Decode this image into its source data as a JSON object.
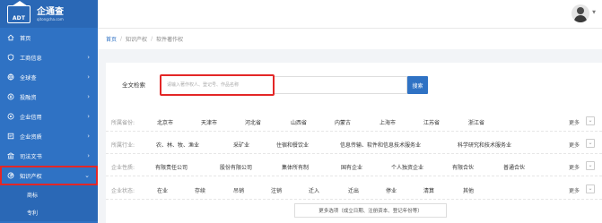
{
  "sidebar": {
    "logo": {
      "abbr": "ADT",
      "name": "企通查",
      "url": "qitongcha.com"
    },
    "items": [
      {
        "label": "首页",
        "icon": "home-icon",
        "has_arrow": false
      },
      {
        "label": "工商信息",
        "icon": "shield-icon",
        "has_arrow": true
      },
      {
        "label": "全球查",
        "icon": "globe-icon",
        "has_arrow": true
      },
      {
        "label": "投融资",
        "icon": "money-icon",
        "has_arrow": true
      },
      {
        "label": "企业信用",
        "icon": "credit-icon",
        "has_arrow": true
      },
      {
        "label": "企业资质",
        "icon": "certificate-icon",
        "has_arrow": true
      },
      {
        "label": "司法文书",
        "icon": "court-icon",
        "has_arrow": true
      },
      {
        "label": "知识产权",
        "icon": "ip-icon",
        "has_arrow": true,
        "expanded": true
      }
    ],
    "subitems": [
      "商标",
      "专利"
    ]
  },
  "breadcrumb": {
    "home": "首页",
    "level1": "知识产权",
    "level2": "软件著作权",
    "sep": "/"
  },
  "search": {
    "label": "全文检索",
    "placeholder": "请输入著作权人、登记号、作品名称",
    "button": "搜索"
  },
  "filters": [
    {
      "label": "所属省份:",
      "options": [
        "北京市",
        "天津市",
        "河北省",
        "山西省",
        "内蒙古",
        "上海市",
        "江苏省",
        "浙江省"
      ],
      "more": "更多"
    },
    {
      "label": "所属行业:",
      "options": [
        "农、林、牧、渔业",
        "采矿业",
        "住宿和餐饮业",
        "信息传输、软件和信息技术服务业",
        "科学研究和技术服务业"
      ],
      "more": "更多"
    },
    {
      "label": "企业性质:",
      "options": [
        "有限责任公司",
        "股份有限公司",
        "集体所有制",
        "国有企业",
        "个人独资企业",
        "有限合伙",
        "普通合伙"
      ],
      "more": "更多"
    },
    {
      "label": "企业状态:",
      "options": [
        "在业",
        "存续",
        "吊销",
        "注销",
        "迁入",
        "迁出",
        "停业",
        "清算",
        "其他"
      ],
      "more": "更多"
    }
  ],
  "more_options": "更多选项（成立日期、注册资本、登记年份等）",
  "colors": {
    "brand": "#2f72c4",
    "highlight": "#e32727"
  }
}
